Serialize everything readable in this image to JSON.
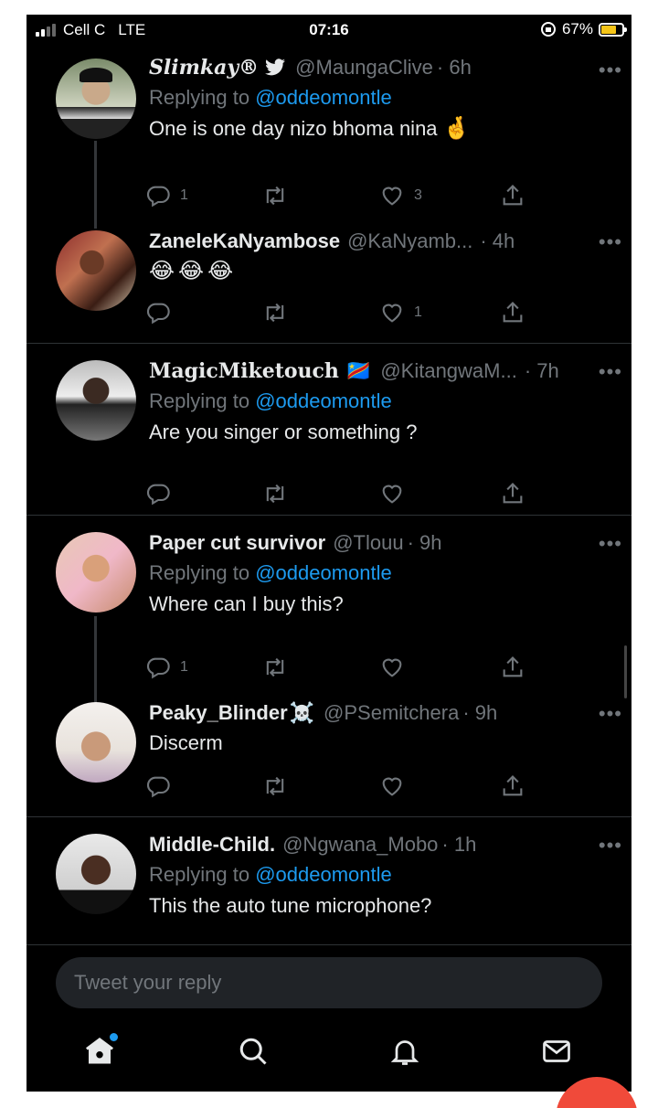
{
  "status_bar": {
    "carrier": "Cell C",
    "network": "LTE",
    "time": "07:16",
    "battery": "67%",
    "battery_level": 0.67
  },
  "tweets": [
    {
      "name": "Slimkay®",
      "name_icon": "bird-icon",
      "handle": "@MaungaClive",
      "time": "· 6h",
      "replying_label": "Replying to",
      "reply_to": "@oddeomontle",
      "text": "One is one day nizo bhoma nina",
      "emoji": "🤞",
      "replies": "1",
      "likes": "3"
    },
    {
      "name": "ZaneleKaNyambose",
      "handle": "@KaNyamb...",
      "time": "· 4h",
      "text": "😂😂😂",
      "replies": "",
      "likes": "1"
    },
    {
      "name": "MagicMiketouch",
      "flag": "🇨🇩",
      "handle": "@KitangwaM...",
      "time": "· 7h",
      "replying_label": "Replying to",
      "reply_to": "@oddeomontle",
      "text": "Are you singer or something ?",
      "replies": "",
      "likes": ""
    },
    {
      "name": "Paper cut survivor",
      "handle": "@Tlouu",
      "time": "· 9h",
      "replying_label": "Replying to",
      "reply_to": "@oddeomontle",
      "text": "Where can I buy this?",
      "replies": "1",
      "likes": ""
    },
    {
      "name": "Peaky_Blinder",
      "name_emoji": "☠️",
      "handle": "@PSemitchera",
      "time": "· 9h",
      "text": "Discerm",
      "replies": "",
      "likes": ""
    },
    {
      "name": "Middle-Child.",
      "handle": "@Ngwana_Mobo",
      "time": "· 1h",
      "replying_label": "Replying to",
      "reply_to": "@oddeomontle",
      "text": "This the auto tune microphone?"
    }
  ],
  "more_label": "•••",
  "composer": {
    "placeholder": "Tweet your reply"
  },
  "tabbar": {
    "items": [
      "home-icon",
      "search-icon",
      "notifications-icon",
      "messages-icon"
    ]
  },
  "colors": {
    "background": "#000000",
    "accent": "#1d9bf0",
    "muted": "#71767b",
    "text": "#e7e9ea",
    "fab": "#f04a3a"
  }
}
